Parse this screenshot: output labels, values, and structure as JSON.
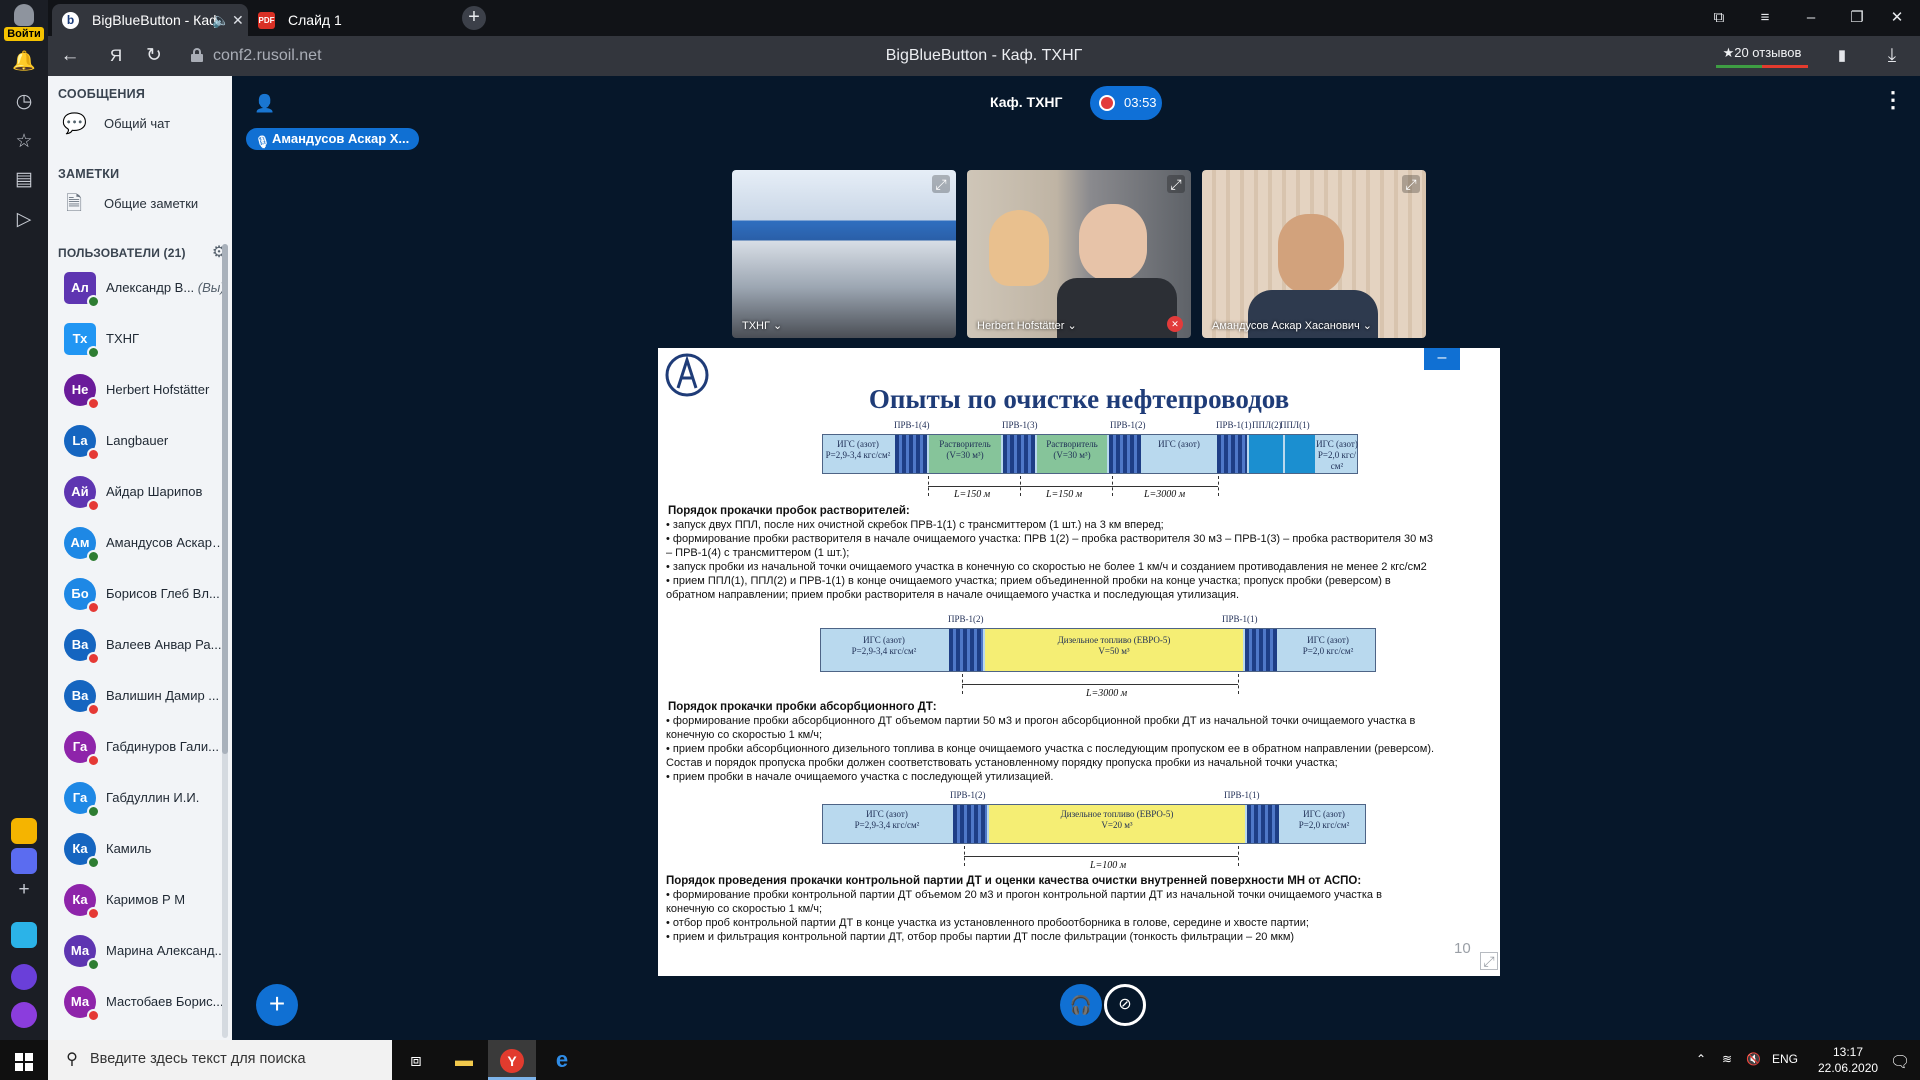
{
  "browser": {
    "tabs": [
      {
        "label": "BigBlueButton - Каф"
      },
      {
        "label": "Слайд 1"
      }
    ],
    "url": "conf2.rusoil.net",
    "page_title": "BigBlueButton - Каф. ТХНГ",
    "reviews": "★20 отзывов",
    "yandex_letter": "Я",
    "avatar_login": "Войти"
  },
  "panel": {
    "messages_title": "СООБЩЕНИЯ",
    "public_chat": "Общий чат",
    "notes_title": "ЗАМЕТКИ",
    "shared_notes": "Общие заметки",
    "users_title": "ПОЛЬЗОВАТЕЛИ (21)",
    "users": [
      {
        "initials": "Ал",
        "name": "Александр В...",
        "suffix": "(Вы)",
        "color": "#5E35B1",
        "status": "#2E7D32",
        "square": true
      },
      {
        "initials": "Тх",
        "name": "ТХНГ",
        "color": "#2196F3",
        "status": "#2E7D32",
        "square": true
      },
      {
        "initials": "He",
        "name": "Herbert Hofstätter",
        "color": "#6A1B9A",
        "status": "#E53935"
      },
      {
        "initials": "La",
        "name": "Langbauer",
        "color": "#1565C0",
        "status": "#E53935"
      },
      {
        "initials": "Ай",
        "name": "Айдар Шарипов",
        "color": "#5E35B1",
        "status": "#E53935"
      },
      {
        "initials": "Ам",
        "name": "Амандусов Аскар ...",
        "color": "#1E88E5",
        "status": "#2E7D32"
      },
      {
        "initials": "Бо",
        "name": "Борисов Глеб Вл...",
        "color": "#1E88E5",
        "status": "#E53935"
      },
      {
        "initials": "Ва",
        "name": "Валеев Анвар Ра...",
        "color": "#1565C0",
        "status": "#E53935"
      },
      {
        "initials": "Ва",
        "name": "Валишин Дамир ...",
        "color": "#1565C0",
        "status": "#E53935"
      },
      {
        "initials": "Га",
        "name": "Габдинуров Гали...",
        "color": "#8E24AA",
        "status": "#E53935"
      },
      {
        "initials": "Га",
        "name": "Габдуллин И.И.",
        "color": "#1E88E5",
        "status": "#2E7D32"
      },
      {
        "initials": "Ка",
        "name": "Камиль",
        "color": "#1565C0",
        "status": "#2E7D32"
      },
      {
        "initials": "Ка",
        "name": "Каримов Р М",
        "color": "#8E24AA",
        "status": "#E53935"
      },
      {
        "initials": "Ма",
        "name": "Марина Александ...",
        "color": "#5E35B1",
        "status": "#2E7D32"
      },
      {
        "initials": "Ма",
        "name": "Мастобаев Борис...",
        "color": "#8E24AA",
        "status": "#E53935"
      }
    ]
  },
  "meeting": {
    "room": "Каф. ТХНГ",
    "timer": "03:53",
    "talker": "Амандусов Аскар Х...",
    "videos": [
      {
        "name": "ТХНГ ⌄"
      },
      {
        "name": "Herbert Hofstätter ⌄"
      },
      {
        "name": "Амандусов Аскар Хасанович ⌄"
      }
    ]
  },
  "slide": {
    "title": "Опыты по очистке нефтепроводов",
    "page_number": "10",
    "minimize": "–",
    "diagram1": {
      "labels": [
        "ПРВ-1(4)",
        "ПРВ-1(3)",
        "ПРВ-1(2)",
        "ПРВ-1(1)",
        "ППЛ(2)",
        "ППЛ(1)"
      ],
      "segments": [
        {
          "a": "ИГС (азот)",
          "b": "P=2,9-3,4 кгс/см²"
        },
        {
          "a": "Растворитель",
          "b": "(V=30 м³)"
        },
        {
          "a": "Растворитель",
          "b": "(V=30 м³)"
        },
        {
          "a": "ИГС (азот)",
          "b": ""
        },
        {
          "a": "ИГС (азот)",
          "b": "P=2,0 кгс/см²"
        }
      ],
      "dims": [
        "L=150 м",
        "L=150 м",
        "L=3000 м"
      ]
    },
    "section1": {
      "heading": "Порядок прокачки пробок растворителей:",
      "lines": [
        "• запуск двух ППЛ, после них очистной скребок ПРВ-1(1) с трансмиттером (1 шт.) на 3 км вперед;",
        "• формирование пробки растворителя в начале очищаемого участка: ПРВ 1(2) – пробка растворителя 30 м3 – ПРВ-1(3) – пробка растворителя 30 м3",
        "– ПРВ-1(4) с трансмиттером (1 шт.);",
        "• запуск пробки из начальной точки очищаемого участка в конечную со скоростью не более 1 км/ч и созданием противодавления не менее 2 кгс/см2",
        "• прием ППЛ(1), ППЛ(2) и ПРВ-1(1) в конце очищаемого участка; прием объединенной пробки на конце участка; пропуск пробки (реверсом) в",
        "обратном направлении; прием пробки растворителя в начале очищаемого участка и последующая утилизация."
      ]
    },
    "diagram2": {
      "labels": [
        "ПРВ-1(2)",
        "ПРВ-1(1)"
      ],
      "segments": [
        {
          "a": "ИГС (азот)",
          "b": "P=2,9-3,4 кгс/см²"
        },
        {
          "a": "Дизельное топливо (ЕВРО-5)",
          "b": "V=50 м³"
        },
        {
          "a": "ИГС (азот)",
          "b": "P=2,0 кгс/см²"
        }
      ],
      "dim": "L=3000 м"
    },
    "section2": {
      "heading": "Порядок прокачки пробки абсорбционного ДТ:",
      "lines": [
        "• формирование пробки абсорбционного ДТ объемом партии 50 м3 и прогон абсорбционной пробки ДТ из начальной точки очищаемого участка в",
        "конечную со скоростью 1 км/ч;",
        "• прием пробки абсорбционного дизельного топлива в конце очищаемого участка с последующим пропуском ее в обратном направлении (реверсом).",
        "Состав и порядок пропуска пробки должен соответствовать установленному порядку пропуска пробки из начальной точки участка;",
        "• прием пробки в начале очищаемого участка с последующей утилизацией."
      ]
    },
    "diagram3": {
      "labels": [
        "ПРВ-1(2)",
        "ПРВ-1(1)"
      ],
      "segments": [
        {
          "a": "ИГС (азот)",
          "b": "P=2,9-3,4 кгс/см²"
        },
        {
          "a": "Дизельное топливо (ЕВРО-5)",
          "b": "V=20 м³"
        },
        {
          "a": "ИГС (азот)",
          "b": "P=2,0 кгс/см²"
        }
      ],
      "dim": "L=100 м"
    },
    "section3": {
      "heading": "Порядок проведения прокачки контрольной партии ДТ и оценки качества очистки внутренней поверхности МН от АСПО:",
      "lines": [
        "• формирование пробки контрольной партии ДТ объемом 20 м3 и прогон контрольной партии ДТ из начальной точки очищаемого участка в",
        "конечную со скоростью 1 км/ч;",
        "• отбор проб контрольной партии ДТ в конце участка из установленного пробоотборника в голове, середине и хвосте партии;",
        "• прием и фильтрация контрольной партии ДТ, отбор пробы партии ДТ после фильтрации (тонкость фильтрации – 20 мкм)"
      ]
    }
  },
  "taskbar": {
    "search_placeholder": "Введите здесь текст для поиска",
    "lang": "ENG",
    "time": "13:17",
    "date": "22.06.2020"
  }
}
